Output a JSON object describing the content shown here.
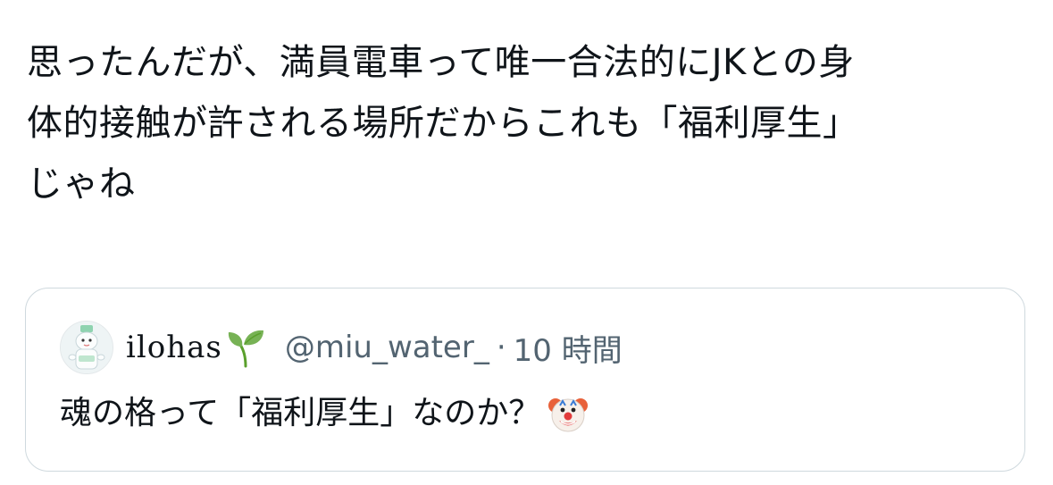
{
  "post": {
    "lines": [
      "思ったんだが、満員電車って唯一合法的にJKとの身",
      "体的接触が許される場所だからこれも「福利厚生」",
      "じゃね"
    ]
  },
  "quote": {
    "display_name": "ilohas",
    "display_name_emoji": "sprout-icon",
    "handle": "@miu_water_",
    "separator": "·",
    "time": "10 時間",
    "text": "魂の格って「福利厚生」なのか？",
    "text_emoji": "clown-face-icon"
  },
  "colors": {
    "text": "#0f1419",
    "secondary": "#536471",
    "border": "#cfd9de"
  }
}
